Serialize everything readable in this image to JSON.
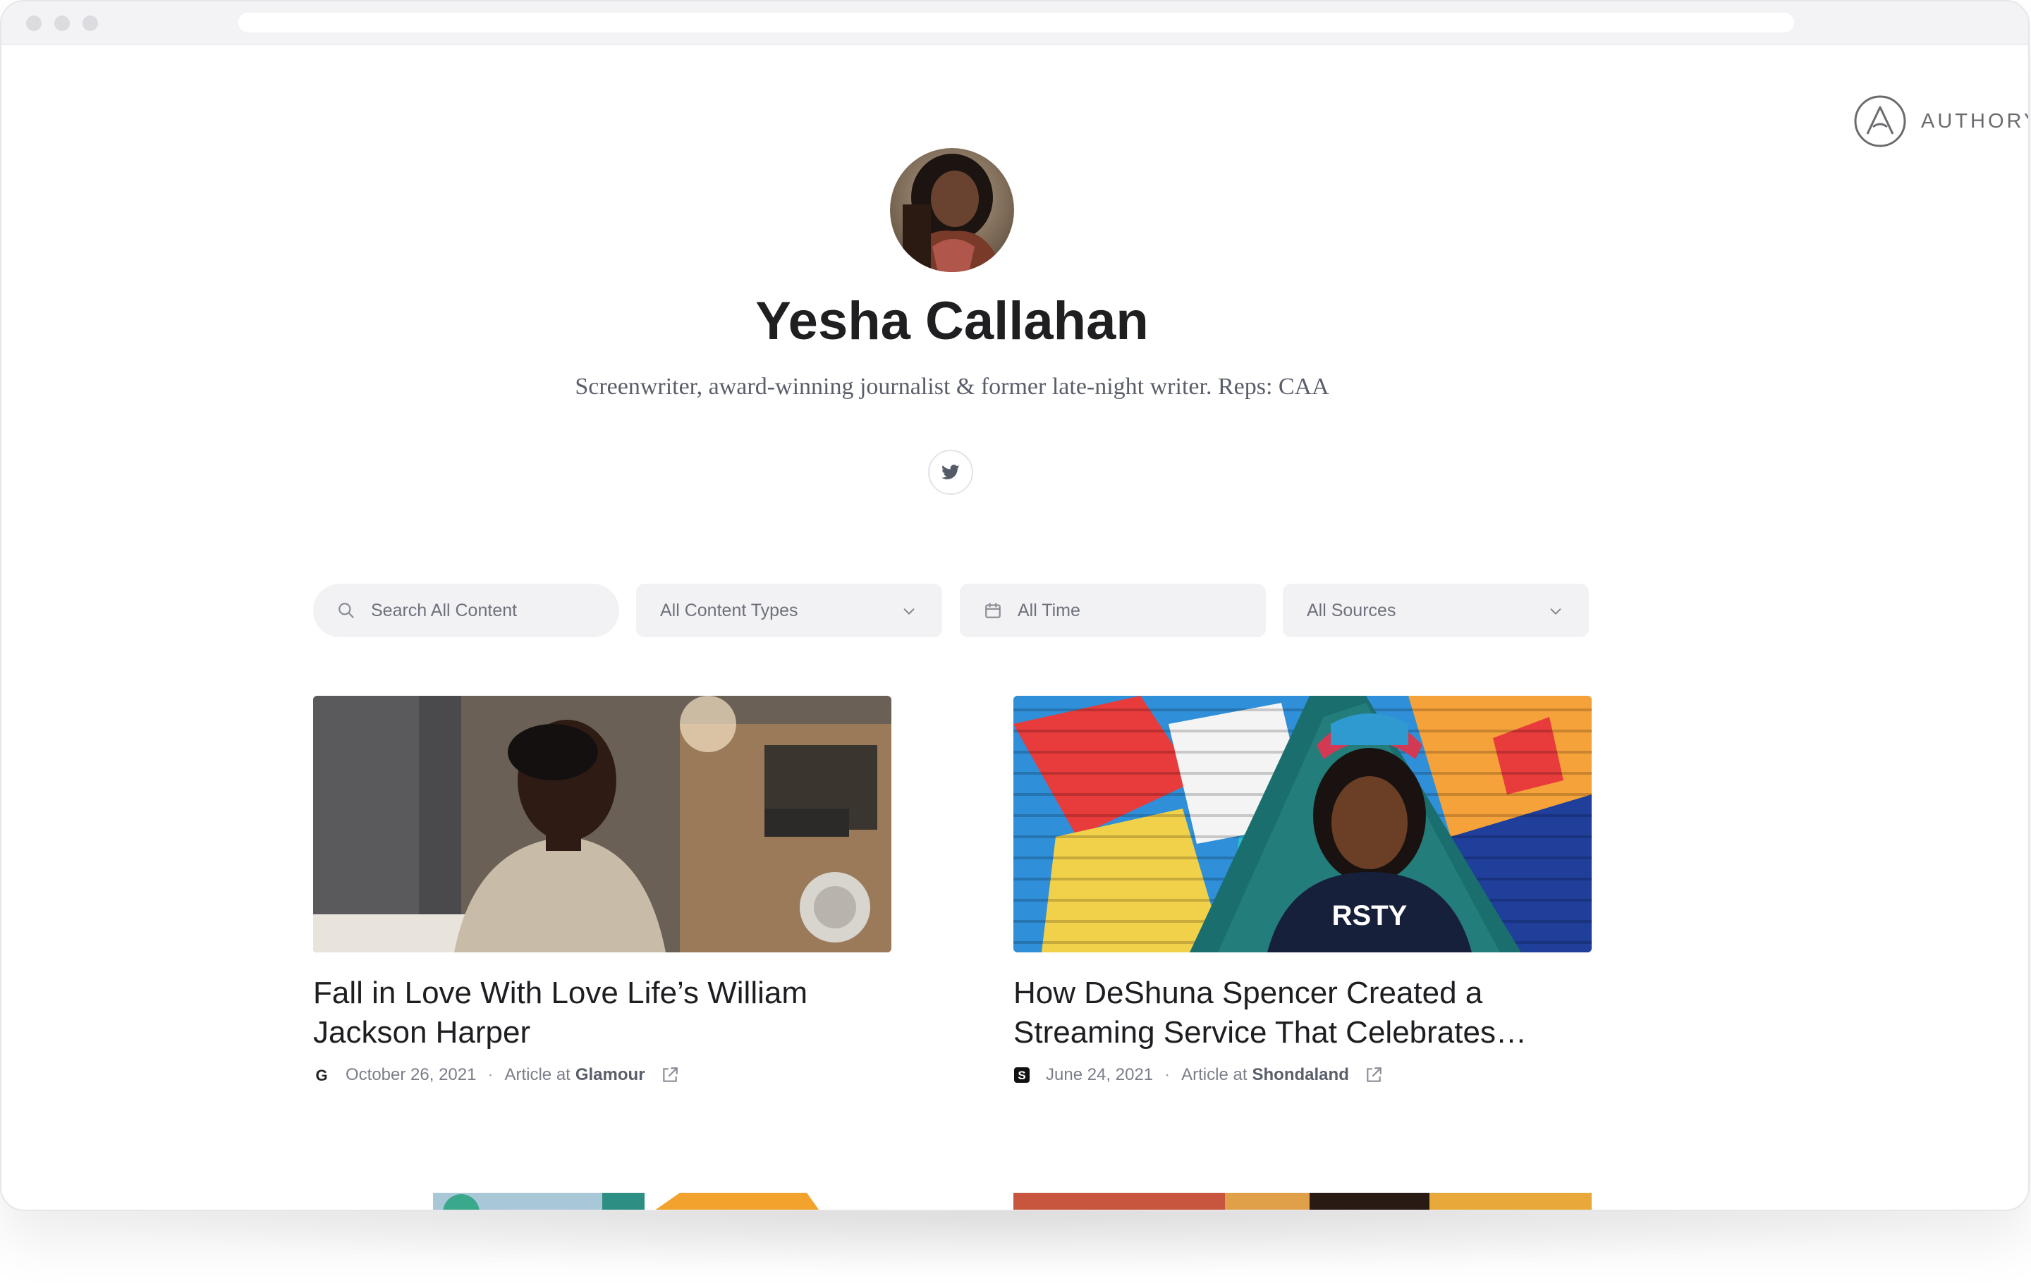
{
  "brand": {
    "name": "AUTHORY"
  },
  "profile": {
    "name": "Yesha Callahan",
    "bio": "Screenwriter, award-winning journalist & former late-night writer. Reps: CAA",
    "social": [
      "twitter-icon"
    ]
  },
  "filters": {
    "search_placeholder": "Search All Content",
    "content_types": "All Content Types",
    "time": "All Time",
    "sources": "All Sources"
  },
  "articles": [
    {
      "title": "Fall in Love With Love Life’s William Jackson Harper",
      "date": "October 26, 2021",
      "type": "Article at",
      "publication": "Glamour",
      "source_icon": "glamour-g-icon"
    },
    {
      "title": "How DeShuna Spencer Created a Streaming Service That Celebrates…",
      "date": "June 24, 2021",
      "type": "Article at",
      "publication": "Shondaland",
      "source_icon": "shondaland-s-icon"
    }
  ],
  "meta_separator": "·",
  "colors": {
    "background": "#ffffff",
    "filter_bg": "#f2f2f4",
    "text_dark": "#1e1e22",
    "text_muted": "#7b7e88"
  }
}
